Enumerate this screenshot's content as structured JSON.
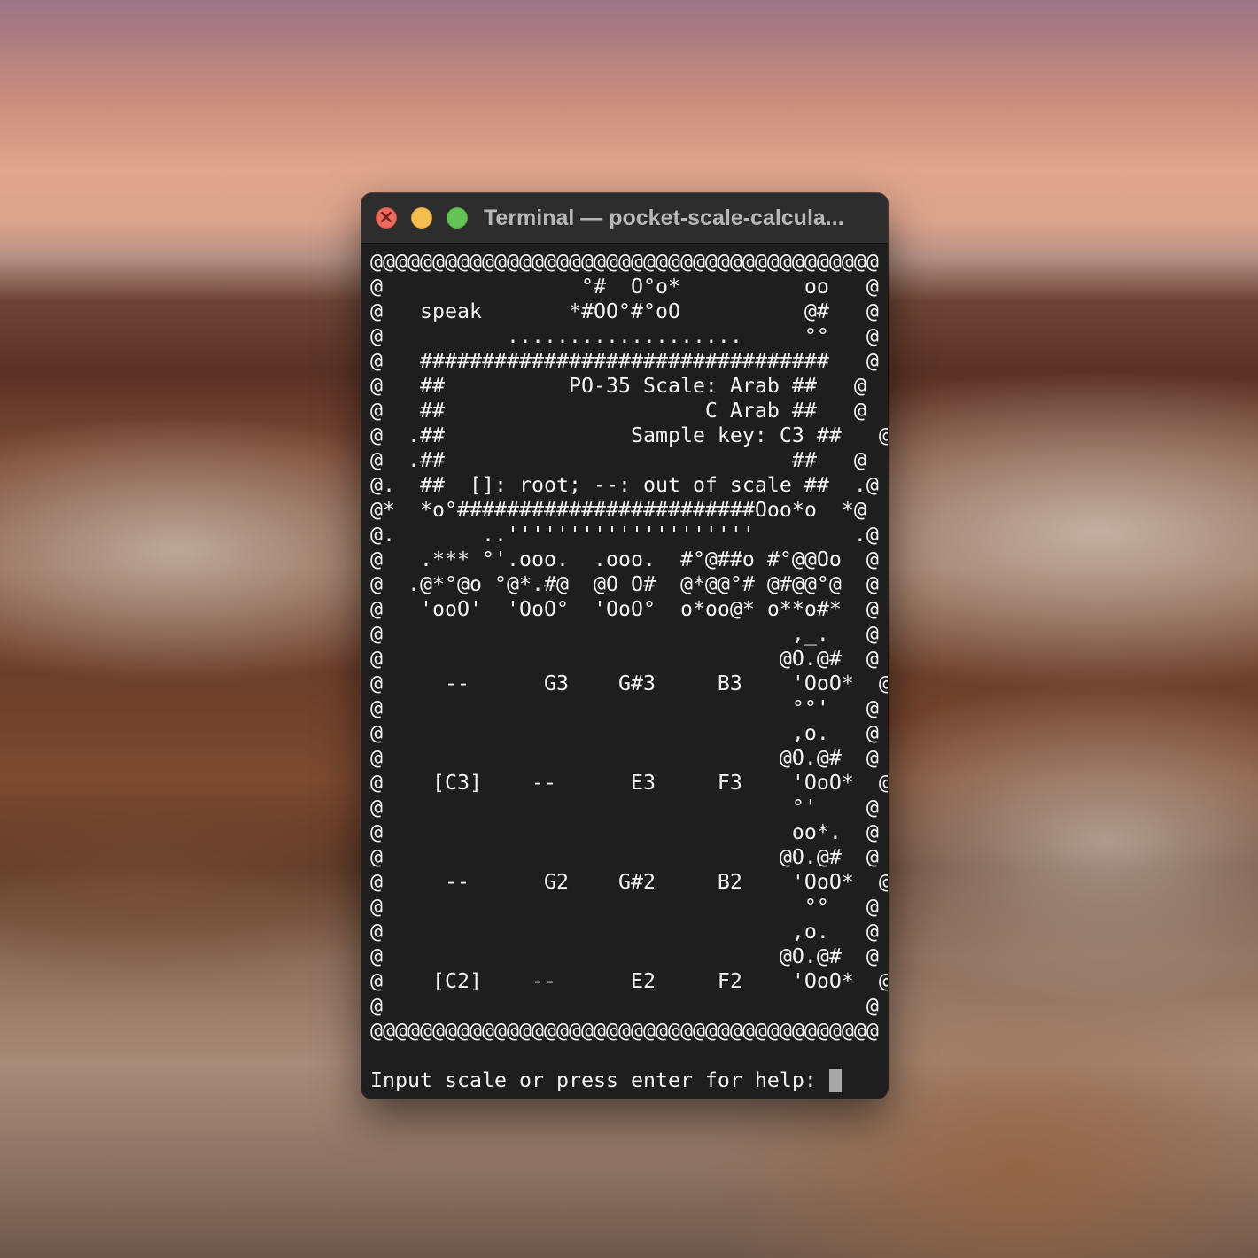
{
  "window": {
    "title": "Terminal — pocket-scale-calcula..."
  },
  "terminal": {
    "lines": [
      "@@@@@@@@@@@@@@@@@@@@@@@@@@@@@@@@@@@@@@@@@",
      "@                °#  O°o*          oo   @",
      "@   speak       *#OO°#°oO          @#   @",
      "@          ...................     °°   @",
      "@   #################################   @",
      "@   ##          PO-35 Scale: Arab ##   @",
      "@   ##                     C Arab ##   @",
      "@  .##               Sample key: C3 ##   @",
      "@  .##                            ##   @",
      "@.  ##  []: root; --: out of scale ##  .@",
      "@*  *o°########################Ooo*o  *@",
      "@.       ..''''''''''''''''''''        .@",
      "@   .*** °'.ooo.  .ooo.  #°@##o #°@@Oo  @",
      "@  .@*°@o °@*.#@  @O O#  @*@@°# @#@@°@  @",
      "@   'ooO'  'OoO°  'OoO°  o*oo@* o**o#*  @",
      "@                                 ,_.   @",
      "@                                @O.@#  @",
      "@     --      G3    G#3     B3    'OoO*  @",
      "@                                 °°'   @",
      "@                                 ,o.   @",
      "@                                @O.@#  @",
      "@    [C3]    --      E3     F3    'OoO*  @",
      "@                                 °'    @",
      "@                                 oo*.  @",
      "@                                @O.@#  @",
      "@     --      G2    G#2     B2    'OoO*  @",
      "@                                  °°   @",
      "@                                 ,o.   @",
      "@                                @O.@#  @",
      "@    [C2]    --      E2     F2    'OoO*  @",
      "@                                       @",
      "@@@@@@@@@@@@@@@@@@@@@@@@@@@@@@@@@@@@@@@@@"
    ],
    "prompt": "Input scale or press enter for help:"
  }
}
